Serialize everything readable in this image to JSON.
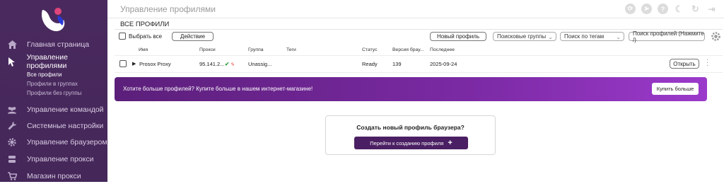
{
  "sidebar": {
    "items": [
      {
        "label": "Главная страница",
        "icon": "home-icon"
      },
      {
        "label": "Управление профилями",
        "icon": "cursor-icon"
      },
      {
        "label": "Управление командой",
        "icon": "users-icon"
      },
      {
        "label": "Системные настройки",
        "icon": "wrench-icon"
      },
      {
        "label": "Управление браузером",
        "icon": "gear-icon"
      },
      {
        "label": "Управление прокси",
        "icon": "server-icon"
      },
      {
        "label": "Магазин прокси",
        "icon": "cart-icon"
      }
    ],
    "subitems": [
      "Все профили",
      "Профили в группах",
      "Профили без группы"
    ]
  },
  "header": {
    "title": "Управление профилями",
    "icons": [
      "sync-icon",
      "telegram-icon",
      "help-icon",
      "moon-icon",
      "refresh-icon",
      "logout-icon"
    ]
  },
  "section_title": "ВСЕ ПРОФИЛИ",
  "toolbar": {
    "select_all": "Выбрать все",
    "action": "Действие",
    "new_profile": "Новый профиль",
    "search_groups": "Поисковые группы",
    "search_tags": "Поиск по тегам",
    "search_profiles": "Поиск профилей (Нажмите /)"
  },
  "table": {
    "headers": [
      "Имя",
      "Прокси",
      "Группа",
      "Теги",
      "Статус",
      "Версия брау...",
      "Последнее"
    ],
    "rows": [
      {
        "name": "Prosox Proxy",
        "proxy": "95.141.2...",
        "group": "Unassig...",
        "tags": "",
        "status": "Ready",
        "version": "139",
        "last": "2025-09-24",
        "open": "Открыть"
      }
    ]
  },
  "banner": {
    "text": "Хотите больше профилей? Купите больше в нашем интернет-магазине!",
    "button": "Купить больше"
  },
  "create_card": {
    "title": "Создать новый профиль браузера?",
    "button": "Перейти к созданию профиля"
  },
  "colors": {
    "sidebar_bg": "#4a2a5e",
    "banner_start": "#5b1f7a",
    "banner_end": "#9b3acb",
    "accent": "#4b1f63"
  }
}
